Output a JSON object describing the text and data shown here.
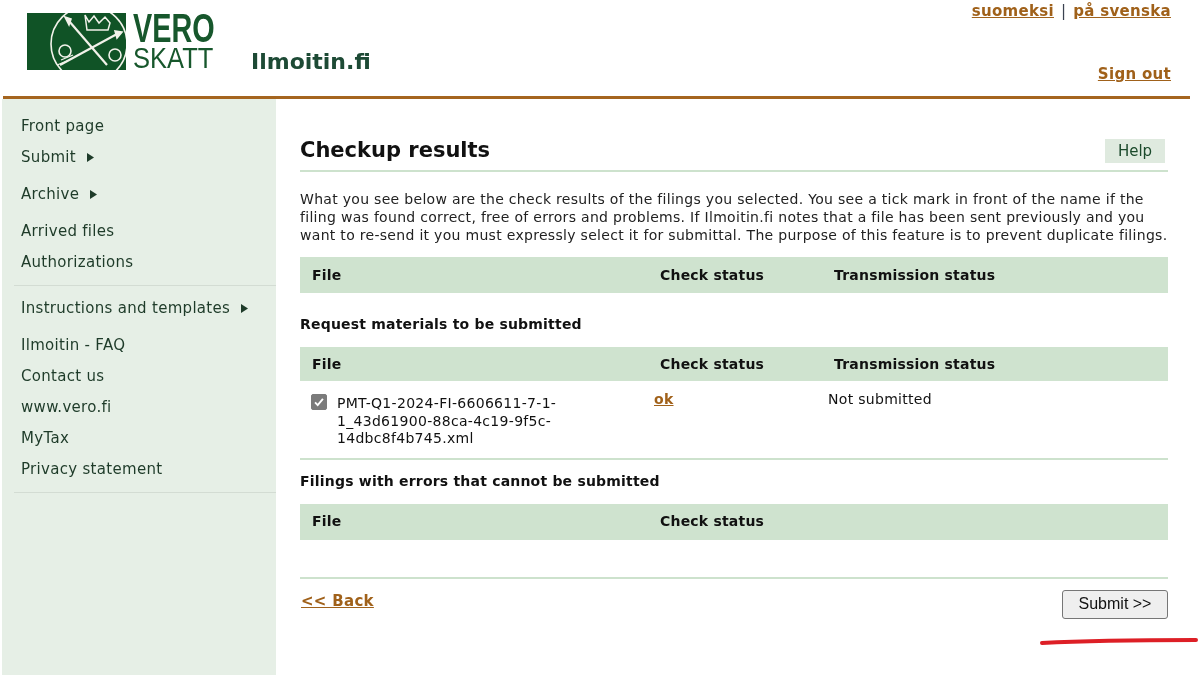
{
  "header": {
    "logo": {
      "lines": [
        "VERO",
        "SKATT"
      ]
    },
    "site_title": "Ilmoitin.fi",
    "languages": [
      {
        "label": "suomeksi"
      },
      {
        "label": "på svenska"
      }
    ],
    "separator": "|",
    "sign_out": "Sign out"
  },
  "sidebar": {
    "groups": [
      {
        "items": [
          {
            "label": "Front page",
            "has_submenu": false
          },
          {
            "label": "Submit",
            "has_submenu": true
          },
          {
            "label": "Archive",
            "has_submenu": true
          },
          {
            "label": "Arrived files",
            "has_submenu": false
          },
          {
            "label": "Authorizations",
            "has_submenu": false
          }
        ]
      },
      {
        "items": [
          {
            "label": "Instructions and templates",
            "has_submenu": true
          },
          {
            "label": "Ilmoitin - FAQ",
            "has_submenu": false
          },
          {
            "label": "Contact us",
            "has_submenu": false
          },
          {
            "label": "www.vero.fi",
            "has_submenu": false
          },
          {
            "label": "MyTax",
            "has_submenu": false
          },
          {
            "label": "Privacy statement",
            "has_submenu": false
          }
        ]
      }
    ]
  },
  "main": {
    "title": "Checkup results",
    "help_button": "Help",
    "intro": "What you see below are the check results of the filings you selected. You see a tick mark in front of the name if the filing was found correct, free of errors and problems. If Ilmoitin.fi notes that a file has been sent previously and you want to re-send it you must expressly select it for submittal. The purpose of this feature is to prevent duplicate filings.",
    "sections": [
      {
        "columns": [
          "File",
          "Check status",
          "Transmission status"
        ]
      },
      {
        "heading": "Request materials to be submitted",
        "columns": [
          "File",
          "Check status",
          "Transmission status"
        ],
        "rows": [
          {
            "checked": true,
            "disabled": true,
            "file": "PMT-Q1-2024-FI-6606611-7-1-1_43d61900-88ca-4c19-9f5c-14dbc8f4b745.xml",
            "check_status": "ok",
            "transmission_status": "Not submitted"
          }
        ]
      },
      {
        "heading": "Filings with errors that cannot be submitted",
        "columns": [
          "File",
          "Check status"
        ]
      }
    ],
    "back_link": "<< Back",
    "submit_button": "Submit >>"
  }
}
